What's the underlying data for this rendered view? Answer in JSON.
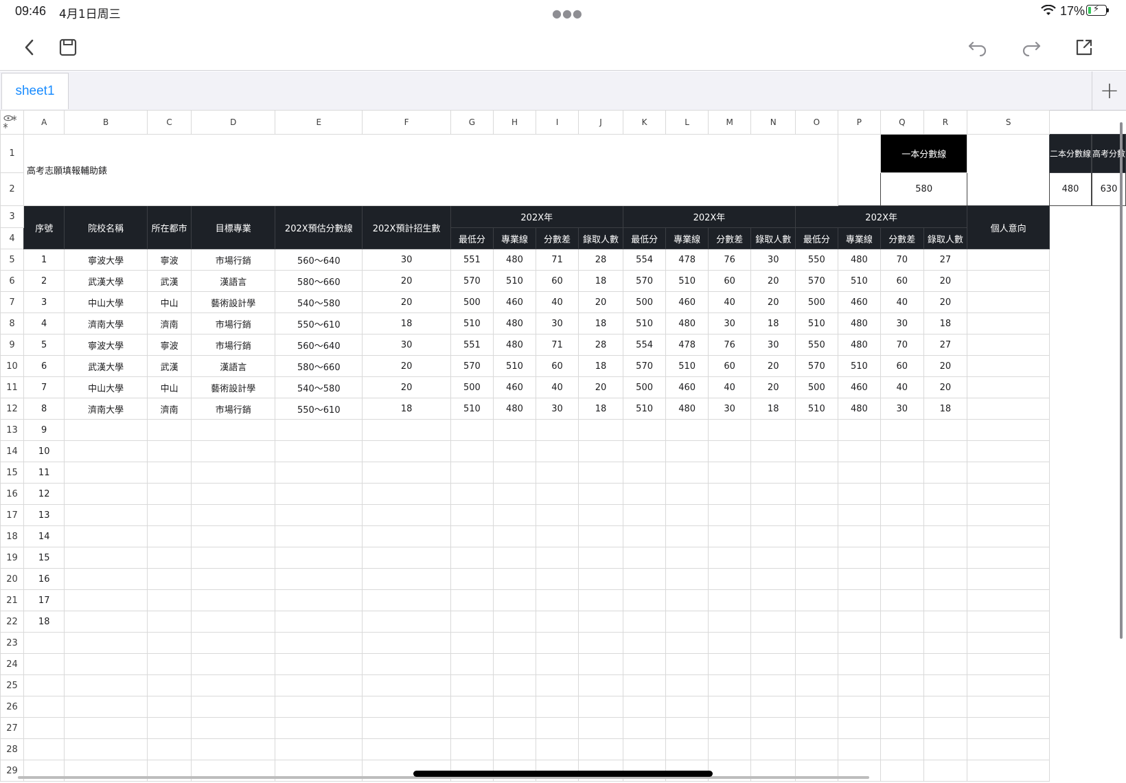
{
  "status": {
    "time": "09:46",
    "date": "4月1日周三",
    "battery": "17%",
    "battery_level": 0.17
  },
  "toolbar": {
    "back_icon": "chevron-left-icon",
    "save_icon": "save-disk-icon",
    "undo_icon": "undo-icon",
    "redo_icon": "redo-icon",
    "share_icon": "share-icon"
  },
  "tabs": [
    {
      "label": "sheet1",
      "active": true
    }
  ],
  "columns": [
    "A",
    "B",
    "C",
    "D",
    "E",
    "F",
    "G",
    "H",
    "I",
    "J",
    "K",
    "L",
    "M",
    "N",
    "O",
    "P",
    "Q",
    "R",
    "S"
  ],
  "row_numbers": [
    "1",
    "2",
    "3",
    "4",
    "5",
    "6",
    "7",
    "8",
    "9",
    "10",
    "11",
    "12",
    "13",
    "14",
    "15",
    "16",
    "17",
    "18",
    "19",
    "20",
    "21",
    "22",
    "23",
    "24",
    "25",
    "26",
    "27",
    "28",
    "29"
  ],
  "sheet": {
    "title": "高考志願填報輔助錶",
    "line1_label": "一本分數線",
    "line1_value": "580",
    "line2_label": "二本分數線",
    "line2_value": "480",
    "score_label": "高考分數",
    "score_value": "630",
    "headers": {
      "seq": "序號",
      "school": "院校名稱",
      "city": "所在都市",
      "major": "目標專業",
      "predicted_line": "202X預估分數線",
      "planned_enroll": "202X預計招生數",
      "year1": "202X年",
      "year2": "202X年",
      "year3": "202X年",
      "intent": "個人意向",
      "sub": [
        "最低分",
        "專業線",
        "分數差",
        "錄取人數",
        "最低分",
        "專業線",
        "分數差",
        "錄取人數",
        "最低分",
        "專業線",
        "分數差",
        "錄取人數"
      ]
    },
    "rows": [
      [
        "1",
        "寧波大學",
        "寧波",
        "市場行銷",
        "560～640",
        "30",
        "551",
        "480",
        "71",
        "28",
        "554",
        "478",
        "76",
        "30",
        "550",
        "480",
        "70",
        "27",
        ""
      ],
      [
        "2",
        "武漢大學",
        "武漢",
        "漢語言",
        "580～660",
        "20",
        "570",
        "510",
        "60",
        "18",
        "570",
        "510",
        "60",
        "20",
        "570",
        "510",
        "60",
        "20",
        ""
      ],
      [
        "3",
        "中山大學",
        "中山",
        "藝術設計學",
        "540～580",
        "20",
        "500",
        "460",
        "40",
        "20",
        "500",
        "460",
        "40",
        "20",
        "500",
        "460",
        "40",
        "20",
        ""
      ],
      [
        "4",
        "濟南大學",
        "濟南",
        "市場行銷",
        "550～610",
        "18",
        "510",
        "480",
        "30",
        "18",
        "510",
        "480",
        "30",
        "18",
        "510",
        "480",
        "30",
        "18",
        ""
      ],
      [
        "5",
        "寧波大學",
        "寧波",
        "市場行銷",
        "560～640",
        "30",
        "551",
        "480",
        "71",
        "28",
        "554",
        "478",
        "76",
        "30",
        "550",
        "480",
        "70",
        "27",
        ""
      ],
      [
        "6",
        "武漢大學",
        "武漢",
        "漢語言",
        "580～660",
        "20",
        "570",
        "510",
        "60",
        "18",
        "570",
        "510",
        "60",
        "20",
        "570",
        "510",
        "60",
        "20",
        ""
      ],
      [
        "7",
        "中山大學",
        "中山",
        "藝術設計學",
        "540～580",
        "20",
        "500",
        "460",
        "40",
        "20",
        "500",
        "460",
        "40",
        "20",
        "500",
        "460",
        "40",
        "20",
        ""
      ],
      [
        "8",
        "濟南大學",
        "濟南",
        "市場行銷",
        "550～610",
        "18",
        "510",
        "480",
        "30",
        "18",
        "510",
        "480",
        "30",
        "18",
        "510",
        "480",
        "30",
        "18",
        ""
      ],
      [
        "9",
        "",
        "",
        "",
        "",
        "",
        "",
        "",
        "",
        "",
        "",
        "",
        "",
        "",
        "",
        "",
        "",
        "",
        ""
      ],
      [
        "10",
        "",
        "",
        "",
        "",
        "",
        "",
        "",
        "",
        "",
        "",
        "",
        "",
        "",
        "",
        "",
        "",
        "",
        ""
      ],
      [
        "11",
        "",
        "",
        "",
        "",
        "",
        "",
        "",
        "",
        "",
        "",
        "",
        "",
        "",
        "",
        "",
        "",
        "",
        ""
      ],
      [
        "12",
        "",
        "",
        "",
        "",
        "",
        "",
        "",
        "",
        "",
        "",
        "",
        "",
        "",
        "",
        "",
        "",
        "",
        ""
      ],
      [
        "13",
        "",
        "",
        "",
        "",
        "",
        "",
        "",
        "",
        "",
        "",
        "",
        "",
        "",
        "",
        "",
        "",
        "",
        ""
      ],
      [
        "14",
        "",
        "",
        "",
        "",
        "",
        "",
        "",
        "",
        "",
        "",
        "",
        "",
        "",
        "",
        "",
        "",
        "",
        ""
      ],
      [
        "15",
        "",
        "",
        "",
        "",
        "",
        "",
        "",
        "",
        "",
        "",
        "",
        "",
        "",
        "",
        "",
        "",
        "",
        ""
      ],
      [
        "16",
        "",
        "",
        "",
        "",
        "",
        "",
        "",
        "",
        "",
        "",
        "",
        "",
        "",
        "",
        "",
        "",
        "",
        ""
      ],
      [
        "17",
        "",
        "",
        "",
        "",
        "",
        "",
        "",
        "",
        "",
        "",
        "",
        "",
        "",
        "",
        "",
        "",
        "",
        ""
      ],
      [
        "18",
        "",
        "",
        "",
        "",
        "",
        "",
        "",
        "",
        "",
        "",
        "",
        "",
        "",
        "",
        "",
        "",
        "",
        ""
      ],
      [
        "",
        "",
        "",
        "",
        "",
        "",
        "",
        "",
        "",
        "",
        "",
        "",
        "",
        "",
        "",
        "",
        "",
        "",
        ""
      ],
      [
        "",
        "",
        "",
        "",
        "",
        "",
        "",
        "",
        "",
        "",
        "",
        "",
        "",
        "",
        "",
        "",
        "",
        "",
        ""
      ],
      [
        "",
        "",
        "",
        "",
        "",
        "",
        "",
        "",
        "",
        "",
        "",
        "",
        "",
        "",
        "",
        "",
        "",
        "",
        ""
      ],
      [
        "",
        "",
        "",
        "",
        "",
        "",
        "",
        "",
        "",
        "",
        "",
        "",
        "",
        "",
        "",
        "",
        "",
        "",
        ""
      ],
      [
        "",
        "",
        "",
        "",
        "",
        "",
        "",
        "",
        "",
        "",
        "",
        "",
        "",
        "",
        "",
        "",
        "",
        "",
        ""
      ],
      [
        "",
        "",
        "",
        "",
        "",
        "",
        "",
        "",
        "",
        "",
        "",
        "",
        "",
        "",
        "",
        "",
        "",
        "",
        ""
      ],
      [
        "",
        "",
        "",
        "",
        "",
        "",
        "",
        "",
        "",
        "",
        "",
        "",
        "",
        "",
        "",
        "",
        "",
        "",
        ""
      ]
    ]
  }
}
